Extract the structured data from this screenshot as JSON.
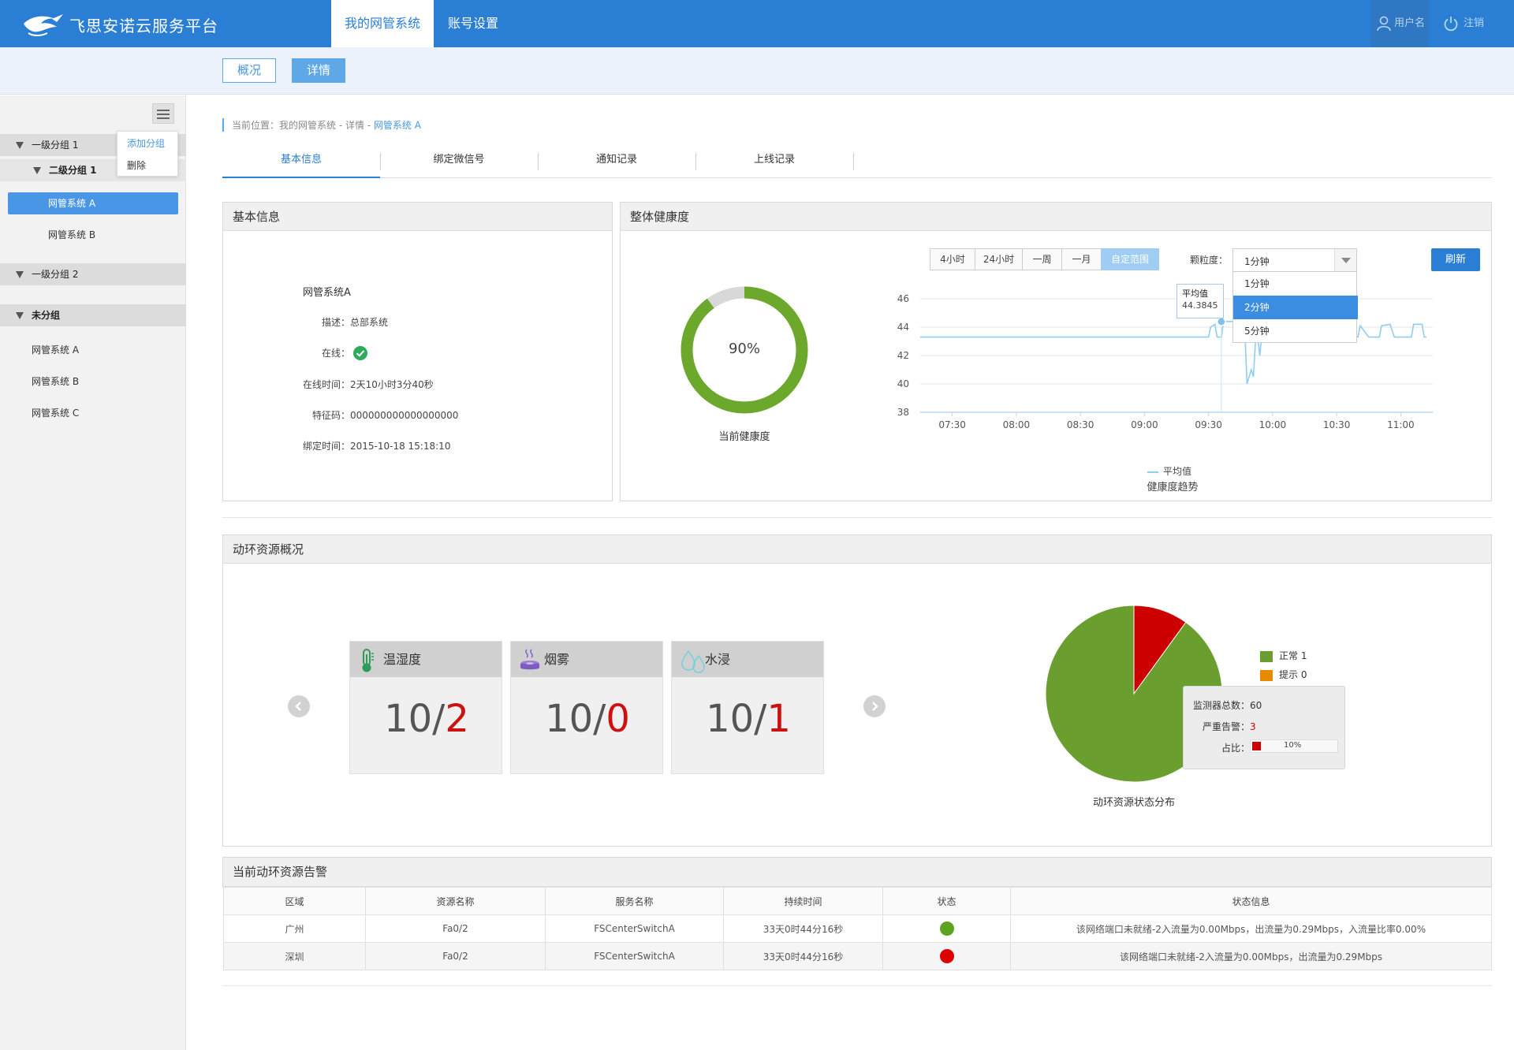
{
  "header": {
    "app_title": "飞思安诺云服务平台",
    "nav": [
      "我的网管系统",
      "账号设置"
    ],
    "user_label": "用户名",
    "logout_label": "注销",
    "colors": {
      "primary": "#2a7fd4",
      "accent": "#5ea8e8"
    }
  },
  "subnav": {
    "overview_label": "概况",
    "detail_label": "详情"
  },
  "sidebar": {
    "menu_popup": {
      "add_group": "添加分组",
      "delete": "删除"
    },
    "groups": [
      {
        "label": "一级分组 1"
      },
      {
        "label": "二级分组 1"
      },
      {
        "label": "一级分组 2"
      },
      {
        "label": "未分组"
      }
    ],
    "items": [
      {
        "label": "网管系统 A",
        "selected": true
      },
      {
        "label": "网管系统 B"
      },
      {
        "label": "网管系统 A"
      },
      {
        "label": "网管系统 B"
      },
      {
        "label": "网管系统 C"
      }
    ]
  },
  "breadcrumb": {
    "prefix": "当前位置：我的网管系统 - 详情 - ",
    "current": "网管系统 A"
  },
  "tabs": [
    "基本信息",
    "绑定微信号",
    "通知记录",
    "上线记录"
  ],
  "basic_info": {
    "panel_title": "基本信息",
    "name": "网管系统A",
    "desc": "描述：总部系统",
    "online_label": "在线：",
    "online_time": "在线时间：2天10小时3分40秒",
    "feature_code": "特征码：000000000000000000",
    "bind_time": "绑定时间：2015-10-18   15:18:10"
  },
  "health": {
    "panel_title": "整体健康度",
    "percent_label": "90%",
    "percent": 90,
    "gauge_caption": "当前健康度",
    "ranges": [
      "4小时",
      "24小时",
      "一周",
      "一月",
      "自定范围"
    ],
    "granularity_label": "颗粒度：",
    "granularity_value": "1分钟",
    "granularity_options": [
      "1分钟",
      "2分钟",
      "5分钟"
    ],
    "refresh_label": "刷新",
    "tooltip_title": "平均值",
    "tooltip_value": "44.3845",
    "legend_label": "平均值",
    "chart_caption": "健康度趋势"
  },
  "chart_data": {
    "type": "line",
    "title": "健康度趋势",
    "x_ticks": [
      "07:30",
      "08:00",
      "08:30",
      "09:00",
      "09:30",
      "10:00",
      "10:30",
      "11:00"
    ],
    "ylim": [
      38,
      46
    ],
    "y_ticks": [
      38,
      40,
      42,
      44,
      46
    ],
    "series": [
      {
        "name": "平均值",
        "color": "#8fcdf2",
        "x": [
          "07:15",
          "09:30",
          "09:31",
          "09:33",
          "09:34",
          "09:36",
          "09:37",
          "09:45",
          "09:47",
          "09:48",
          "09:50",
          "09:51",
          "09:52",
          "09:53",
          "09:54",
          "09:55",
          "09:57",
          "09:58",
          "10:00",
          "10:05",
          "10:06",
          "10:08",
          "10:11",
          "10:12",
          "10:14",
          "10:16",
          "10:18",
          "10:20",
          "10:25",
          "10:26",
          "10:30",
          "10:35",
          "10:36",
          "10:38",
          "10:40",
          "10:41",
          "10:45",
          "10:50",
          "10:51",
          "10:55",
          "10:57",
          "10:59",
          "11:05",
          "11:06",
          "11:08",
          "11:10",
          "11:11",
          "11:12"
        ],
        "y": [
          43.3,
          43.3,
          44.0,
          44.2,
          43.3,
          43.3,
          44.4,
          44.4,
          43.8,
          40.0,
          41.0,
          40.5,
          43.0,
          43.4,
          42.0,
          43.5,
          43.3,
          43.8,
          43.3,
          43.3,
          44.1,
          43.3,
          43.3,
          44.1,
          44.1,
          43.3,
          43.3,
          43.3,
          43.3,
          44.1,
          43.3,
          43.3,
          44.1,
          43.3,
          43.3,
          44.1,
          43.3,
          43.3,
          44.1,
          44.2,
          43.3,
          43.3,
          43.3,
          44.2,
          44.2,
          44.2,
          43.3,
          43.3
        ]
      }
    ]
  },
  "env": {
    "panel_title": "动环资源概况",
    "cards": [
      {
        "title": "温湿度",
        "total": "10/",
        "alarm": "2",
        "icon": "thermometer-icon"
      },
      {
        "title": "烟雾",
        "total": "10/",
        "alarm": "0",
        "icon": "smoke-detector-icon"
      },
      {
        "title": "水浸",
        "total": "10/",
        "alarm": "1",
        "icon": "water-drop-icon"
      }
    ],
    "pie_caption": "动环资源状态分布",
    "pie_legend": [
      {
        "label": "正常 1",
        "color": "#6a9e2e"
      },
      {
        "label": "提示 0",
        "color": "#e88a00"
      }
    ],
    "pie_tooltip": {
      "total_label": "监测器总数：60",
      "severe_label": "严重告警：",
      "severe_value": "3",
      "ratio_label": "占比：",
      "ratio_value": "10%"
    }
  },
  "pie_data": {
    "type": "pie",
    "slices": [
      {
        "label": "正常",
        "value": 90,
        "color": "#6a9e2e"
      },
      {
        "label": "严重告警",
        "value": 10,
        "color": "#cc0000"
      }
    ]
  },
  "alarms": {
    "panel_title": "当前动环资源告警",
    "columns": [
      "区域",
      "资源名称",
      "服务名称",
      "持续时间",
      "状态",
      "状态信息"
    ],
    "rows": [
      {
        "area": "广州",
        "resource": "Fa0/2",
        "service": "FSCenterSwitchA",
        "duration": "33天0时44分16秒",
        "status_color": "#5ea320",
        "info": "该网络端口未就绪-2入流量为0.00Mbps，出流量为0.29Mbps，入流量比率0.00%"
      },
      {
        "area": "深圳",
        "resource": "Fa0/2",
        "service": "FSCenterSwitchA",
        "duration": "33天0时44分16秒",
        "status_color": "#dd0000",
        "info": "该网络端口未就绪-2入流量为0.00Mbps，出流量为0.29Mbps"
      }
    ]
  }
}
